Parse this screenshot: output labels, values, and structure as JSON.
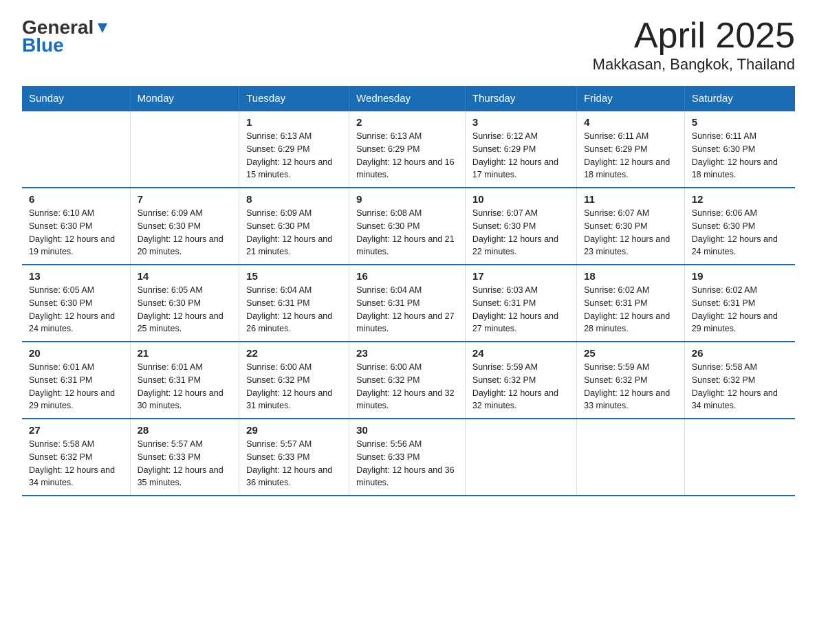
{
  "logo": {
    "general": "General",
    "blue": "Blue"
  },
  "title": "April 2025",
  "subtitle": "Makkasan, Bangkok, Thailand",
  "weekdays": [
    "Sunday",
    "Monday",
    "Tuesday",
    "Wednesday",
    "Thursday",
    "Friday",
    "Saturday"
  ],
  "weeks": [
    [
      {
        "day": "",
        "sunrise": "",
        "sunset": "",
        "daylight": ""
      },
      {
        "day": "",
        "sunrise": "",
        "sunset": "",
        "daylight": ""
      },
      {
        "day": "1",
        "sunrise": "Sunrise: 6:13 AM",
        "sunset": "Sunset: 6:29 PM",
        "daylight": "Daylight: 12 hours and 15 minutes."
      },
      {
        "day": "2",
        "sunrise": "Sunrise: 6:13 AM",
        "sunset": "Sunset: 6:29 PM",
        "daylight": "Daylight: 12 hours and 16 minutes."
      },
      {
        "day": "3",
        "sunrise": "Sunrise: 6:12 AM",
        "sunset": "Sunset: 6:29 PM",
        "daylight": "Daylight: 12 hours and 17 minutes."
      },
      {
        "day": "4",
        "sunrise": "Sunrise: 6:11 AM",
        "sunset": "Sunset: 6:29 PM",
        "daylight": "Daylight: 12 hours and 18 minutes."
      },
      {
        "day": "5",
        "sunrise": "Sunrise: 6:11 AM",
        "sunset": "Sunset: 6:30 PM",
        "daylight": "Daylight: 12 hours and 18 minutes."
      }
    ],
    [
      {
        "day": "6",
        "sunrise": "Sunrise: 6:10 AM",
        "sunset": "Sunset: 6:30 PM",
        "daylight": "Daylight: 12 hours and 19 minutes."
      },
      {
        "day": "7",
        "sunrise": "Sunrise: 6:09 AM",
        "sunset": "Sunset: 6:30 PM",
        "daylight": "Daylight: 12 hours and 20 minutes."
      },
      {
        "day": "8",
        "sunrise": "Sunrise: 6:09 AM",
        "sunset": "Sunset: 6:30 PM",
        "daylight": "Daylight: 12 hours and 21 minutes."
      },
      {
        "day": "9",
        "sunrise": "Sunrise: 6:08 AM",
        "sunset": "Sunset: 6:30 PM",
        "daylight": "Daylight: 12 hours and 21 minutes."
      },
      {
        "day": "10",
        "sunrise": "Sunrise: 6:07 AM",
        "sunset": "Sunset: 6:30 PM",
        "daylight": "Daylight: 12 hours and 22 minutes."
      },
      {
        "day": "11",
        "sunrise": "Sunrise: 6:07 AM",
        "sunset": "Sunset: 6:30 PM",
        "daylight": "Daylight: 12 hours and 23 minutes."
      },
      {
        "day": "12",
        "sunrise": "Sunrise: 6:06 AM",
        "sunset": "Sunset: 6:30 PM",
        "daylight": "Daylight: 12 hours and 24 minutes."
      }
    ],
    [
      {
        "day": "13",
        "sunrise": "Sunrise: 6:05 AM",
        "sunset": "Sunset: 6:30 PM",
        "daylight": "Daylight: 12 hours and 24 minutes."
      },
      {
        "day": "14",
        "sunrise": "Sunrise: 6:05 AM",
        "sunset": "Sunset: 6:30 PM",
        "daylight": "Daylight: 12 hours and 25 minutes."
      },
      {
        "day": "15",
        "sunrise": "Sunrise: 6:04 AM",
        "sunset": "Sunset: 6:31 PM",
        "daylight": "Daylight: 12 hours and 26 minutes."
      },
      {
        "day": "16",
        "sunrise": "Sunrise: 6:04 AM",
        "sunset": "Sunset: 6:31 PM",
        "daylight": "Daylight: 12 hours and 27 minutes."
      },
      {
        "day": "17",
        "sunrise": "Sunrise: 6:03 AM",
        "sunset": "Sunset: 6:31 PM",
        "daylight": "Daylight: 12 hours and 27 minutes."
      },
      {
        "day": "18",
        "sunrise": "Sunrise: 6:02 AM",
        "sunset": "Sunset: 6:31 PM",
        "daylight": "Daylight: 12 hours and 28 minutes."
      },
      {
        "day": "19",
        "sunrise": "Sunrise: 6:02 AM",
        "sunset": "Sunset: 6:31 PM",
        "daylight": "Daylight: 12 hours and 29 minutes."
      }
    ],
    [
      {
        "day": "20",
        "sunrise": "Sunrise: 6:01 AM",
        "sunset": "Sunset: 6:31 PM",
        "daylight": "Daylight: 12 hours and 29 minutes."
      },
      {
        "day": "21",
        "sunrise": "Sunrise: 6:01 AM",
        "sunset": "Sunset: 6:31 PM",
        "daylight": "Daylight: 12 hours and 30 minutes."
      },
      {
        "day": "22",
        "sunrise": "Sunrise: 6:00 AM",
        "sunset": "Sunset: 6:32 PM",
        "daylight": "Daylight: 12 hours and 31 minutes."
      },
      {
        "day": "23",
        "sunrise": "Sunrise: 6:00 AM",
        "sunset": "Sunset: 6:32 PM",
        "daylight": "Daylight: 12 hours and 32 minutes."
      },
      {
        "day": "24",
        "sunrise": "Sunrise: 5:59 AM",
        "sunset": "Sunset: 6:32 PM",
        "daylight": "Daylight: 12 hours and 32 minutes."
      },
      {
        "day": "25",
        "sunrise": "Sunrise: 5:59 AM",
        "sunset": "Sunset: 6:32 PM",
        "daylight": "Daylight: 12 hours and 33 minutes."
      },
      {
        "day": "26",
        "sunrise": "Sunrise: 5:58 AM",
        "sunset": "Sunset: 6:32 PM",
        "daylight": "Daylight: 12 hours and 34 minutes."
      }
    ],
    [
      {
        "day": "27",
        "sunrise": "Sunrise: 5:58 AM",
        "sunset": "Sunset: 6:32 PM",
        "daylight": "Daylight: 12 hours and 34 minutes."
      },
      {
        "day": "28",
        "sunrise": "Sunrise: 5:57 AM",
        "sunset": "Sunset: 6:33 PM",
        "daylight": "Daylight: 12 hours and 35 minutes."
      },
      {
        "day": "29",
        "sunrise": "Sunrise: 5:57 AM",
        "sunset": "Sunset: 6:33 PM",
        "daylight": "Daylight: 12 hours and 36 minutes."
      },
      {
        "day": "30",
        "sunrise": "Sunrise: 5:56 AM",
        "sunset": "Sunset: 6:33 PM",
        "daylight": "Daylight: 12 hours and 36 minutes."
      },
      {
        "day": "",
        "sunrise": "",
        "sunset": "",
        "daylight": ""
      },
      {
        "day": "",
        "sunrise": "",
        "sunset": "",
        "daylight": ""
      },
      {
        "day": "",
        "sunrise": "",
        "sunset": "",
        "daylight": ""
      }
    ]
  ]
}
